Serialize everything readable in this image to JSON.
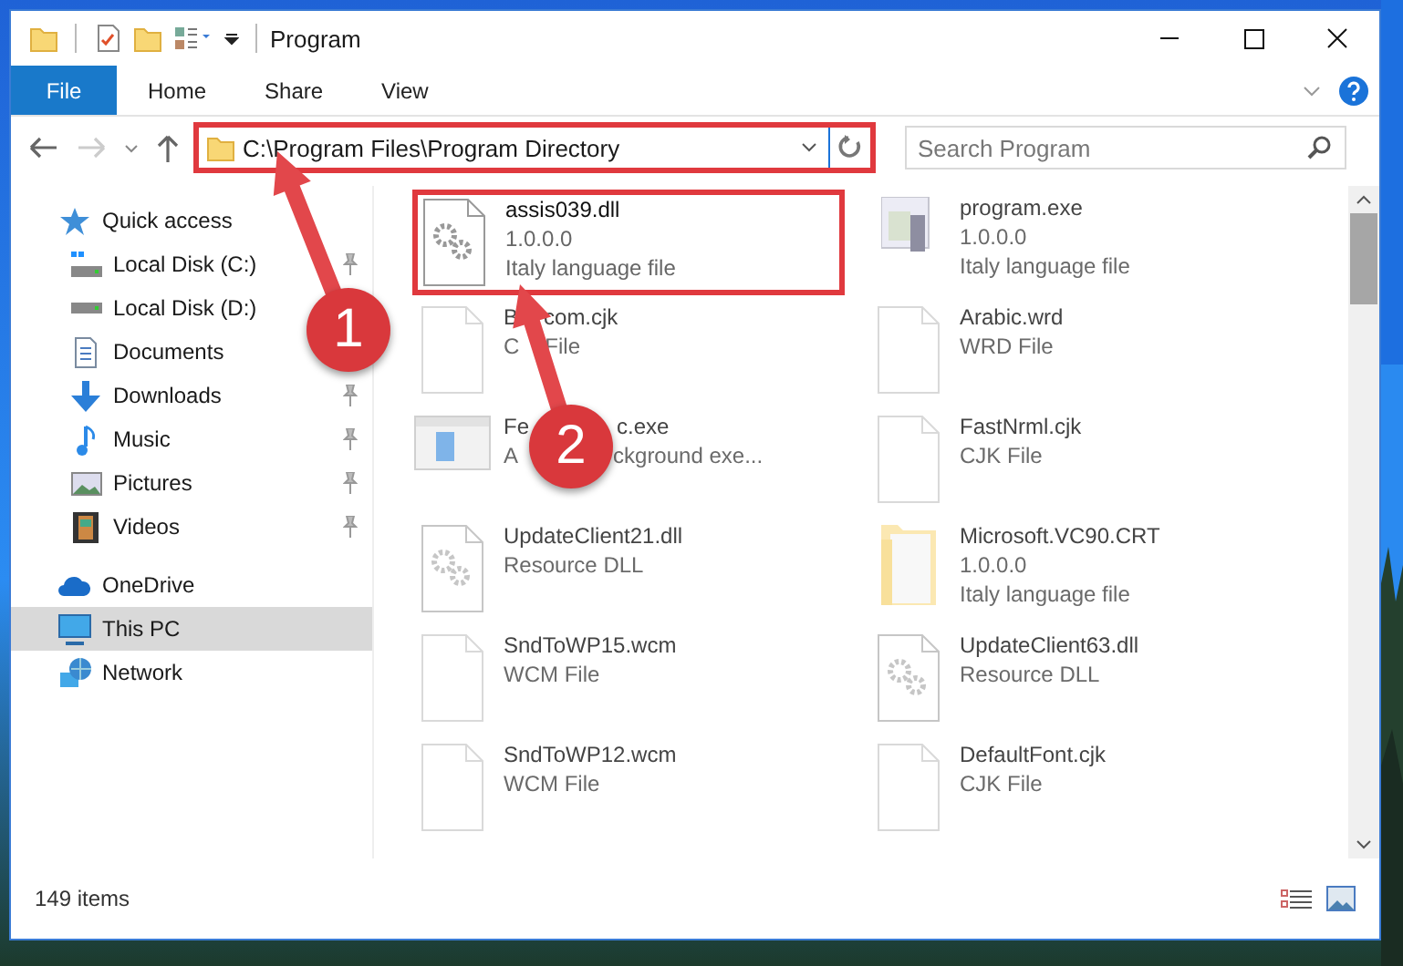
{
  "window": {
    "title": "Program"
  },
  "ribbon_tabs": [
    {
      "label": "File",
      "kind": "file"
    },
    {
      "label": "Home",
      "kind": "tab"
    },
    {
      "label": "Share",
      "kind": "tab"
    },
    {
      "label": "View",
      "kind": "tab"
    }
  ],
  "address": {
    "path": "C:\\Program Files\\Program Directory",
    "highlighted": true
  },
  "search": {
    "placeholder": "Search Program"
  },
  "sidebar": {
    "items": [
      {
        "label": "Quick access",
        "kind": "star",
        "selected": false,
        "children": [
          {
            "label": "Local Disk (C:)",
            "kind": "system",
            "pinned": true,
            "selected": false
          },
          {
            "label": "Local Disk (D:)",
            "kind": "drive",
            "pinned": false,
            "selected": false
          },
          {
            "label": "Documents",
            "kind": "documents",
            "pinned": false,
            "selected": false
          },
          {
            "label": "Downloads",
            "kind": "downloads",
            "pinned": true,
            "selected": false
          },
          {
            "label": "Music",
            "kind": "music",
            "pinned": true,
            "selected": false
          },
          {
            "label": "Pictures",
            "kind": "pictures",
            "pinned": true,
            "selected": false
          },
          {
            "label": "Videos",
            "kind": "videos",
            "pinned": true,
            "selected": false
          }
        ]
      },
      {
        "label": "OneDrive",
        "kind": "cloud",
        "selected": false
      },
      {
        "label": "This PC",
        "kind": "computer",
        "selected": true
      },
      {
        "label": "Network",
        "kind": "network",
        "selected": false
      }
    ]
  },
  "files": [
    {
      "kind": "gear",
      "faded": false,
      "highlighted": true,
      "lines": [
        [
          "assis039.dll"
        ],
        [
          "1.0.0.0"
        ],
        [
          "Italy language file"
        ]
      ]
    },
    {
      "kind": "exe",
      "faded": true,
      "highlighted": false,
      "lines": [
        [
          "program.exe"
        ],
        [
          "1.0.0.0"
        ],
        [
          "Italy language file"
        ]
      ]
    },
    {
      "kind": "blank",
      "faded": true,
      "highlighted": false,
      "lines": [
        [
          "B",
          "com.cjk"
        ],
        [
          "C",
          "File"
        ]
      ]
    },
    {
      "kind": "blank",
      "faded": true,
      "highlighted": false,
      "lines": [
        [
          "Arabic.wrd"
        ],
        [
          "WRD File"
        ]
      ]
    },
    {
      "kind": "app",
      "faded": true,
      "highlighted": false,
      "lines": [
        [
          "Fe",
          "c.exe"
        ],
        [
          "A",
          "ckground exe..."
        ]
      ]
    },
    {
      "kind": "blank",
      "faded": true,
      "highlighted": false,
      "lines": [
        [
          "FastNrml.cjk"
        ],
        [
          "CJK File"
        ]
      ]
    },
    {
      "kind": "gear",
      "faded": true,
      "highlighted": false,
      "lines": [
        [
          "UpdateClient21.dll"
        ],
        [
          "Resource DLL"
        ]
      ]
    },
    {
      "kind": "folder",
      "faded": true,
      "highlighted": false,
      "lines": [
        [
          "Microsoft.VC90.CRT"
        ],
        [
          "1.0.0.0"
        ],
        [
          "Italy language file"
        ]
      ]
    },
    {
      "kind": "blank",
      "faded": true,
      "highlighted": false,
      "lines": [
        [
          "SndToWP15.wcm"
        ],
        [
          "WCM File"
        ]
      ]
    },
    {
      "kind": "gear",
      "faded": true,
      "highlighted": false,
      "lines": [
        [
          "UpdateClient63.dll"
        ],
        [
          "Resource DLL"
        ]
      ]
    },
    {
      "kind": "blank",
      "faded": true,
      "highlighted": false,
      "lines": [
        [
          "SndToWP12.wcm"
        ],
        [
          "WCM File"
        ]
      ]
    },
    {
      "kind": "blank",
      "faded": true,
      "highlighted": false,
      "lines": [
        [
          "DefaultFont.cjk"
        ],
        [
          "CJK File"
        ]
      ]
    }
  ],
  "callouts": [
    {
      "number": "1"
    },
    {
      "number": "2"
    }
  ],
  "status_bar": {
    "item_count": "149 items"
  }
}
